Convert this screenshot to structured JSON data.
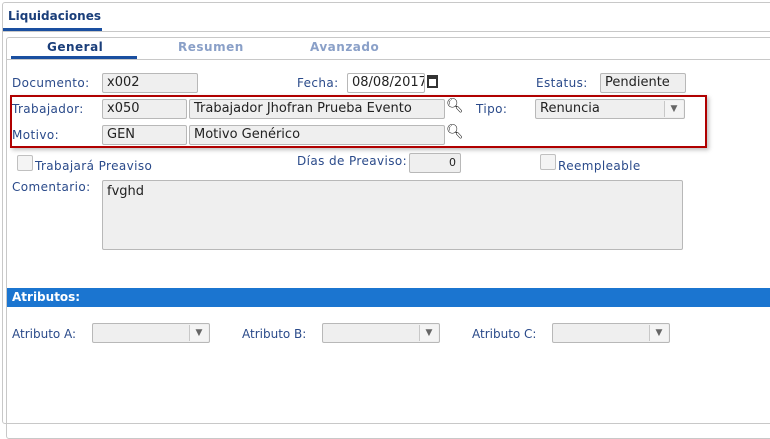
{
  "window": {
    "tab": "Liquidaciones"
  },
  "subtabs": [
    {
      "label": "General"
    },
    {
      "label": "Resumen"
    },
    {
      "label": "Avanzado"
    }
  ],
  "form": {
    "documento": {
      "label": "Documento:",
      "value": "x002"
    },
    "fecha": {
      "label": "Fecha:",
      "value": "08/08/2017"
    },
    "estatus": {
      "label": "Estatus:",
      "value": "Pendiente"
    },
    "trabajador": {
      "label": "Trabajador:",
      "code": "x050",
      "name": "Trabajador Jhofran Prueba Evento"
    },
    "tipo": {
      "label": "Tipo:",
      "value": "Renuncia"
    },
    "motivo": {
      "label": "Motivo:",
      "code": "GEN",
      "name": "Motivo Genérico"
    },
    "trabajara_preaviso": {
      "label": "Trabajará Preaviso",
      "checked": false
    },
    "dias_preaviso": {
      "label": "Días de Preaviso:",
      "value": "0"
    },
    "reempleable": {
      "label": "Reempleable",
      "checked": false
    },
    "comentario": {
      "label": "Comentario:",
      "value": "fvghd"
    }
  },
  "atributos": {
    "title": "Atributos:",
    "a": {
      "label": "Atributo A:",
      "value": ""
    },
    "b": {
      "label": "Atributo B:",
      "value": ""
    },
    "c": {
      "label": "Atributo C:",
      "value": ""
    }
  },
  "colors": {
    "accent": "#1b75d0",
    "highlight": "#b00000"
  }
}
